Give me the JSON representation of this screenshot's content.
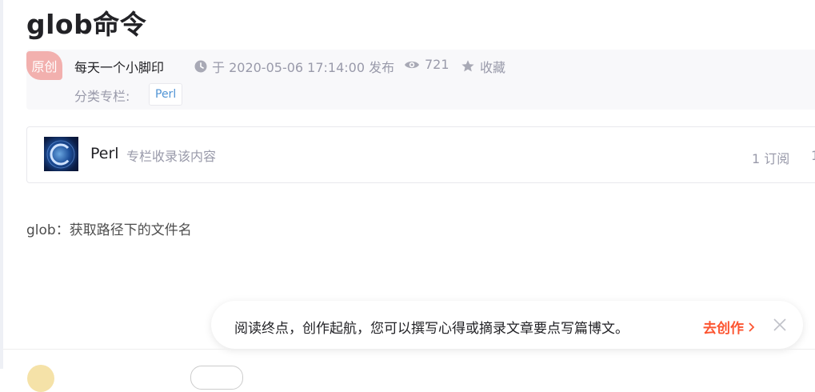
{
  "article": {
    "title": "glob命令",
    "badge": "原创",
    "author": "每天一个小脚印",
    "time": "于 2020-05-06 17:14:00 发布",
    "views": "721",
    "collect": "收藏",
    "category_label": "分类专栏:",
    "category_tag": "Perl",
    "content": "glob：获取路径下的文件名"
  },
  "column": {
    "name": "Perl",
    "description": "专栏收录该内容",
    "subscribe": "1 订阅",
    "trailing": "1"
  },
  "creation_prompt": {
    "text": "阅读终点，创作起航，您可以撰写心得或摘录文章要点写篇博文。",
    "cta": "去创作",
    "accent_color": "#fc5531"
  },
  "icons": {
    "time": "clock-icon",
    "views": "eye-icon",
    "collect": "star-icon",
    "cta_arrow": "chevron-right-icon",
    "close": "close-icon"
  }
}
